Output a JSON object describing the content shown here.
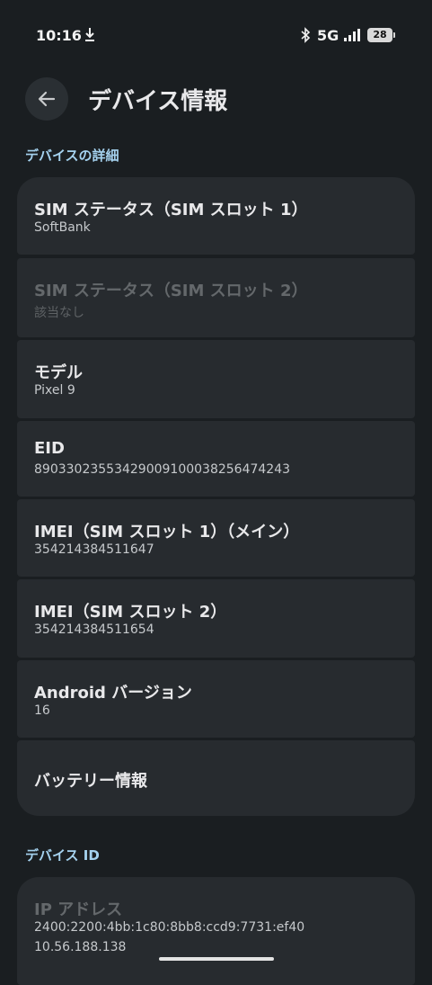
{
  "status_bar": {
    "time": "10:16",
    "network": "5G",
    "battery": "28"
  },
  "header": {
    "title": "デバイス情報"
  },
  "sections": [
    {
      "label": "デバイスの詳細"
    },
    {
      "label": "デバイス ID"
    }
  ],
  "items": [
    {
      "title": "SIM ステータス（SIM スロット 1）",
      "subtitle": "SoftBank"
    },
    {
      "title": "SIM ステータス（SIM スロット 2）",
      "subtitle": "該当なし"
    },
    {
      "title": "モデル",
      "subtitle": "Pixel 9"
    },
    {
      "title": "EID",
      "subtitle": "89033023553429009100038256474243"
    },
    {
      "title": "IMEI（SIM スロット 1）（メイン）",
      "subtitle": "354214384511647"
    },
    {
      "title": "IMEI（SIM スロット 2）",
      "subtitle": "354214384511654"
    },
    {
      "title": "Android バージョン",
      "subtitle": "16"
    },
    {
      "title": "バッテリー情報"
    }
  ],
  "ip": {
    "title": "IP アドレス",
    "ipv6": "2400:2200:4bb:1c80:8bb8:ccd9:7731:ef40",
    "ipv4": "10.56.188.138"
  },
  "colors": {
    "background": "#1a1e21",
    "card": "#272b2f",
    "accent": "#a5d2ef"
  }
}
